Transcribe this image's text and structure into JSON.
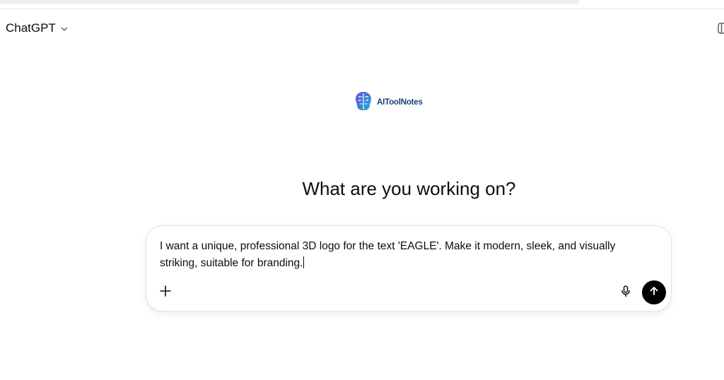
{
  "header": {
    "model_name": "ChatGPT"
  },
  "watermark": {
    "logo_text": "AIToolNotes"
  },
  "main": {
    "heading": "What are you working on?"
  },
  "composer": {
    "prompt_text": "I want a unique, professional 3D logo for the text 'EAGLE'. Make it modern, sleek, and visually striking, suitable for branding.",
    "icons": {
      "add": "plus-icon",
      "voice": "microphone-icon",
      "send": "arrow-up-icon"
    }
  },
  "colors": {
    "send_button": "#000000",
    "logo_text": "#1b3f7a",
    "composer_border": "#e3e3e3"
  }
}
